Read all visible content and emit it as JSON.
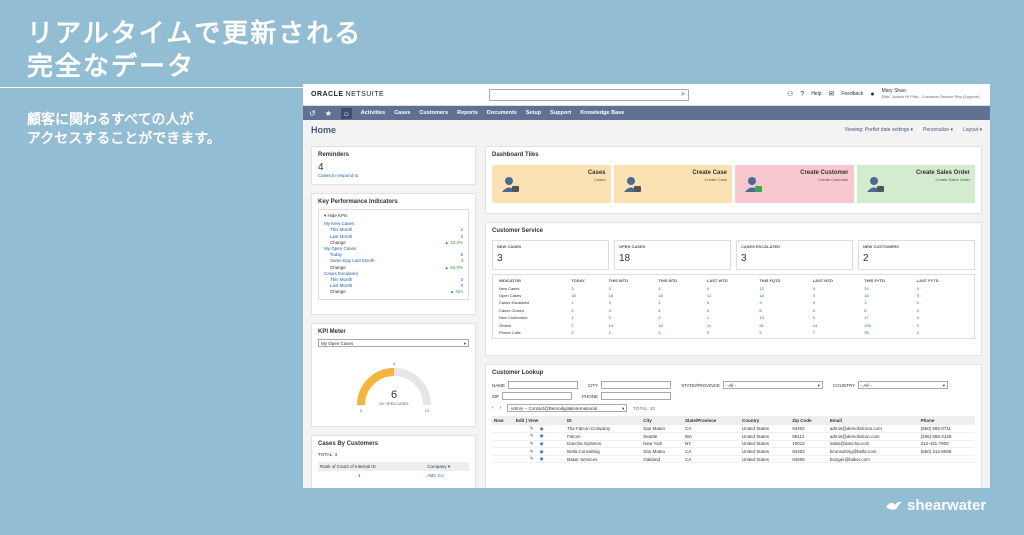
{
  "hero": {
    "title_line1": "リアルタイムで更新される",
    "title_line2": "完全なデータ",
    "subtitle_line1": "顧客に関わるすべての人が",
    "subtitle_line2": "アクセスすることができます。"
  },
  "brand": {
    "name": "shearwater"
  },
  "app": {
    "logo_oracle": "ORACLE",
    "logo_netsuite": "NETSUITE",
    "search_placeholder": "",
    "topbar": {
      "help": "Help",
      "feedback": "Feedback",
      "user_name": "Mary Shao",
      "user_role": "Elite - Admin HI Pilot - Customer Service Rep (Support)"
    },
    "nav": [
      "Activities",
      "Cases",
      "Customers",
      "Reports",
      "Documents",
      "Setup",
      "Support",
      "Knowledge Base"
    ],
    "page_title": "Home",
    "page_options": [
      "Viewing: Portlet date settings ▾",
      "Personalize ▾",
      "Layout ▾"
    ],
    "reminders": {
      "title": "Reminders",
      "count": "4",
      "label": "Cases to respond to"
    },
    "kpi": {
      "title": "Key Performance Indicators",
      "toggle": "▾ Hide KPIs",
      "rows": [
        {
          "label": "My New Cases",
          "value": "",
          "indent": false,
          "link": true
        },
        {
          "label": "This Month",
          "value": "2",
          "indent": true,
          "link": true
        },
        {
          "label": "Last Month",
          "value": "3",
          "indent": true,
          "link": true
        },
        {
          "label": "Change",
          "value": "▲ 33.3%",
          "indent": true,
          "link": false
        },
        {
          "label": "My Open Cases",
          "value": "",
          "indent": false,
          "link": true
        },
        {
          "label": "Today",
          "value": "6",
          "indent": true,
          "link": true
        },
        {
          "label": "Same Day Last Month",
          "value": "4",
          "indent": true,
          "link": true
        },
        {
          "label": "Change",
          "value": "▲ 50.0%",
          "indent": true,
          "link": false
        },
        {
          "label": "Cases Escalated",
          "value": "",
          "indent": false,
          "link": true
        },
        {
          "label": "This Month",
          "value": "3",
          "indent": true,
          "link": true
        },
        {
          "label": "Last Month",
          "value": "0",
          "indent": true,
          "link": true
        },
        {
          "label": "Change",
          "value": "▲ N/A",
          "indent": true,
          "link": false
        }
      ]
    },
    "kpi_meter": {
      "title": "KPI Meter",
      "select": "My Open Cases",
      "value": "6",
      "fraction": 0.5,
      "min": "0",
      "max": "12",
      "mid": "4",
      "label": "MY OPEN CASES"
    },
    "cases_by_customer": {
      "title": "Cases By Customers",
      "total": "TOTAL: 3",
      "col1": "Rank of Count of Internal ID",
      "col2": "Company ▾",
      "rows": [
        {
          "rank": "1",
          "company": "ABC Co."
        }
      ]
    },
    "dashboard_tiles": {
      "title": "Dashboard Tiles",
      "tiles": [
        {
          "title": "Cases",
          "sub": "Cases",
          "color": "#fbe2b2"
        },
        {
          "title": "Create Case",
          "sub": "Create Case",
          "color": "#fbe2b2"
        },
        {
          "title": "Create Customer",
          "sub": "Create Customer",
          "color": "#f8c8cf"
        },
        {
          "title": "Create Sales Order",
          "sub": "Create Sales Order",
          "color": "#d4ebcf"
        }
      ]
    },
    "customer_service": {
      "title": "Customer Service",
      "stats": [
        {
          "label": "NEW CASES",
          "value": "3"
        },
        {
          "label": "OPEN CASES",
          "value": "18"
        },
        {
          "label": "CASES ESCALATED",
          "value": "3"
        },
        {
          "label": "NEW CUSTOMERS",
          "value": "2"
        }
      ],
      "headers": [
        "INDICATOR",
        "TODAY",
        "THIS WTD",
        "THIS MTD",
        "LAST WTD",
        "THIS FQTD",
        "LAST MTD",
        "THIS FYTD",
        "LAST FYTD"
      ],
      "rows": [
        [
          "New Cases",
          "3",
          "3",
          "3",
          "0",
          "12",
          "0",
          "24",
          "0"
        ],
        [
          "Open Cases",
          "18",
          "18",
          "18",
          "12",
          "18",
          "0",
          "18",
          "0"
        ],
        [
          "Cases Escalated",
          "1",
          "3",
          "3",
          "0",
          "3",
          "0",
          "3",
          "0"
        ],
        [
          "Cases Closed",
          "4",
          "4",
          "4",
          "0",
          "8",
          "0",
          "8",
          "0"
        ],
        [
          "New Customers",
          "1",
          "2",
          "3",
          "1",
          "13",
          "2",
          "17",
          "3"
        ],
        [
          "Orders",
          "2",
          "14",
          "18",
          "11",
          "51",
          "14",
          "100",
          "2"
        ],
        [
          "Phone Calls",
          "2",
          "2",
          "3",
          "0",
          "5",
          "7",
          "35",
          "0"
        ]
      ]
    },
    "customer_lookup": {
      "title": "Customer Lookup",
      "fields": {
        "name": "NAME",
        "city": "CITY",
        "state": "STATE/PROVINCE",
        "state_value": "- All -",
        "country": "COUNTRY",
        "country_value": "- All -",
        "zip": "ZIP",
        "phone": "PHONE"
      },
      "view_select": "Admin -- Contact@Demodigitalinternational",
      "total": "TOTAL: 10",
      "headers": [
        "Row",
        "Edit | View",
        "ID",
        "City",
        "State/Province",
        "Country",
        "Zip Code",
        "Email",
        "Phone"
      ],
      "rows": [
        {
          "name": "The Falcon Company",
          "city": "San Mateo",
          "state": "CA",
          "country": "United States",
          "zip": "94404",
          "email": "admin@demofalcons.com",
          "phone": "(650) 555-0711"
        },
        {
          "name": "Falcon",
          "city": "Seattle",
          "state": "WA",
          "country": "United States",
          "zip": "98112",
          "email": "admin@demofalcon.com",
          "phone": "(206) 555-2129"
        },
        {
          "name": "Dancha Systems",
          "city": "New York",
          "state": "NY",
          "country": "United States",
          "zip": "10012",
          "email": "sales@dancha.com",
          "phone": "212-431-7800"
        },
        {
          "name": "Bella Consulting",
          "city": "San Mateo",
          "state": "CA",
          "country": "United States",
          "zip": "94402",
          "email": "bconsulting@bella.com",
          "phone": "(650) 412-6658"
        },
        {
          "name": "Baker Services",
          "city": "Oakland",
          "state": "CA",
          "country": "United States",
          "zip": "94606",
          "email": "bsinger@baker.com",
          "phone": ""
        }
      ]
    }
  }
}
